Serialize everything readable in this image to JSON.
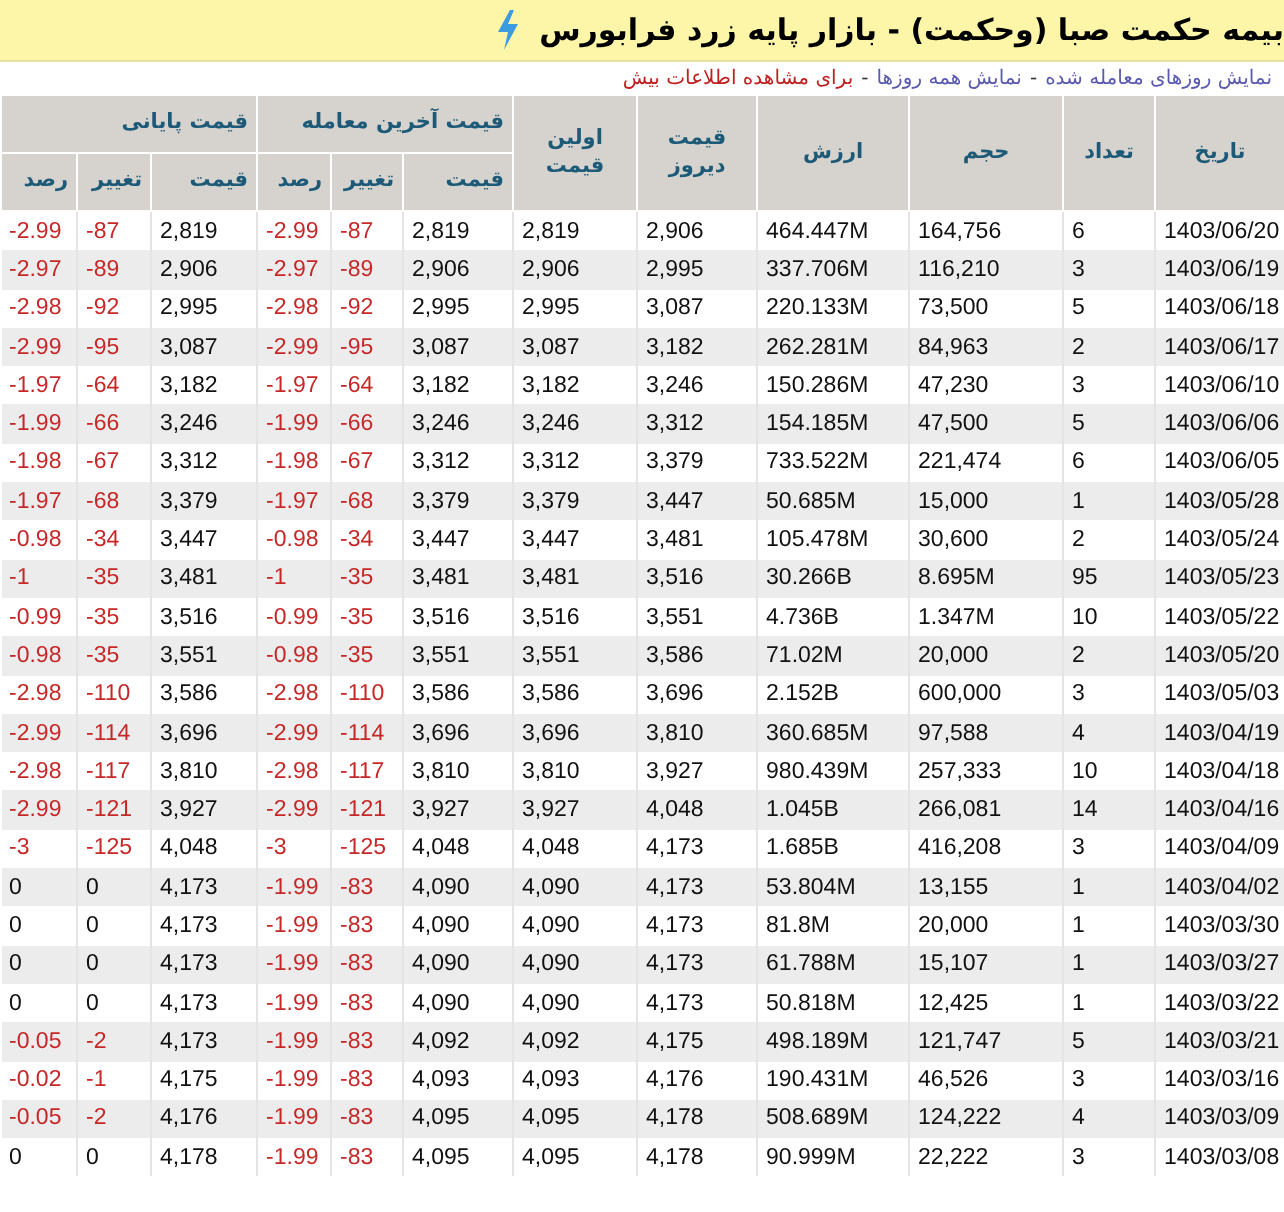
{
  "title": "بیمه حکمت صبا (وحکمت) - بازار پایه زرد فرابورس",
  "links": [
    {
      "text": "نمایش روزهای معامله شده",
      "kind": "link"
    },
    {
      "text": "-",
      "kind": "sep"
    },
    {
      "text": "نمایش همه روزها",
      "kind": "link"
    },
    {
      "text": "-",
      "kind": "sep"
    },
    {
      "text": "برای مشاهده اطلاعات بیش",
      "kind": "alert"
    }
  ],
  "table": {
    "columns": {
      "date": "تاریخ",
      "count": "تعداد",
      "volume": "حجم",
      "value": "ارزش",
      "yesterday_price": "قیمت دیروز",
      "first_price": "اولین قیمت",
      "last_trade": "قیمت آخرین معامله",
      "closing": "قیمت پایانی",
      "last_price": "قیمت",
      "last_change": "تغییر",
      "last_percent": "رصد",
      "close_price": "قیمت",
      "close_change": "تغییر",
      "close_percent": "رصد"
    },
    "rows": [
      {
        "date": "1403/06/20",
        "count": "6",
        "volume": "164,756",
        "value": "464.447M",
        "yesterday_price": "2,906",
        "first_price": "2,819",
        "last_price": "2,819",
        "last_change": "-87",
        "last_percent": "-2.99",
        "last_negative": true,
        "close_price": "2,819",
        "close_change": "-87",
        "close_percent": "-2.99",
        "close_negative": true
      },
      {
        "date": "1403/06/19",
        "count": "3",
        "volume": "116,210",
        "value": "337.706M",
        "yesterday_price": "2,995",
        "first_price": "2,906",
        "last_price": "2,906",
        "last_change": "-89",
        "last_percent": "-2.97",
        "last_negative": true,
        "close_price": "2,906",
        "close_change": "-89",
        "close_percent": "-2.97",
        "close_negative": true
      },
      {
        "date": "1403/06/18",
        "count": "5",
        "volume": "73,500",
        "value": "220.133M",
        "yesterday_price": "3,087",
        "first_price": "2,995",
        "last_price": "2,995",
        "last_change": "-92",
        "last_percent": "-2.98",
        "last_negative": true,
        "close_price": "2,995",
        "close_change": "-92",
        "close_percent": "-2.98",
        "close_negative": true
      },
      {
        "date": "1403/06/17",
        "count": "2",
        "volume": "84,963",
        "value": "262.281M",
        "yesterday_price": "3,182",
        "first_price": "3,087",
        "last_price": "3,087",
        "last_change": "-95",
        "last_percent": "-2.99",
        "last_negative": true,
        "close_price": "3,087",
        "close_change": "-95",
        "close_percent": "-2.99",
        "close_negative": true
      },
      {
        "date": "1403/06/10",
        "count": "3",
        "volume": "47,230",
        "value": "150.286M",
        "yesterday_price": "3,246",
        "first_price": "3,182",
        "last_price": "3,182",
        "last_change": "-64",
        "last_percent": "-1.97",
        "last_negative": true,
        "close_price": "3,182",
        "close_change": "-64",
        "close_percent": "-1.97",
        "close_negative": true
      },
      {
        "date": "1403/06/06",
        "count": "5",
        "volume": "47,500",
        "value": "154.185M",
        "yesterday_price": "3,312",
        "first_price": "3,246",
        "last_price": "3,246",
        "last_change": "-66",
        "last_percent": "-1.99",
        "last_negative": true,
        "close_price": "3,246",
        "close_change": "-66",
        "close_percent": "-1.99",
        "close_negative": true
      },
      {
        "date": "1403/06/05",
        "count": "6",
        "volume": "221,474",
        "value": "733.522M",
        "yesterday_price": "3,379",
        "first_price": "3,312",
        "last_price": "3,312",
        "last_change": "-67",
        "last_percent": "-1.98",
        "last_negative": true,
        "close_price": "3,312",
        "close_change": "-67",
        "close_percent": "-1.98",
        "close_negative": true
      },
      {
        "date": "1403/05/28",
        "count": "1",
        "volume": "15,000",
        "value": "50.685M",
        "yesterday_price": "3,447",
        "first_price": "3,379",
        "last_price": "3,379",
        "last_change": "-68",
        "last_percent": "-1.97",
        "last_negative": true,
        "close_price": "3,379",
        "close_change": "-68",
        "close_percent": "-1.97",
        "close_negative": true
      },
      {
        "date": "1403/05/24",
        "count": "2",
        "volume": "30,600",
        "value": "105.478M",
        "yesterday_price": "3,481",
        "first_price": "3,447",
        "last_price": "3,447",
        "last_change": "-34",
        "last_percent": "-0.98",
        "last_negative": true,
        "close_price": "3,447",
        "close_change": "-34",
        "close_percent": "-0.98",
        "close_negative": true
      },
      {
        "date": "1403/05/23",
        "count": "95",
        "volume": "8.695M",
        "value": "30.266B",
        "yesterday_price": "3,516",
        "first_price": "3,481",
        "last_price": "3,481",
        "last_change": "-35",
        "last_percent": "-1",
        "last_negative": true,
        "close_price": "3,481",
        "close_change": "-35",
        "close_percent": "-1",
        "close_negative": true
      },
      {
        "date": "1403/05/22",
        "count": "10",
        "volume": "1.347M",
        "value": "4.736B",
        "yesterday_price": "3,551",
        "first_price": "3,516",
        "last_price": "3,516",
        "last_change": "-35",
        "last_percent": "-0.99",
        "last_negative": true,
        "close_price": "3,516",
        "close_change": "-35",
        "close_percent": "-0.99",
        "close_negative": true
      },
      {
        "date": "1403/05/20",
        "count": "2",
        "volume": "20,000",
        "value": "71.02M",
        "yesterday_price": "3,586",
        "first_price": "3,551",
        "last_price": "3,551",
        "last_change": "-35",
        "last_percent": "-0.98",
        "last_negative": true,
        "close_price": "3,551",
        "close_change": "-35",
        "close_percent": "-0.98",
        "close_negative": true
      },
      {
        "date": "1403/05/03",
        "count": "3",
        "volume": "600,000",
        "value": "2.152B",
        "yesterday_price": "3,696",
        "first_price": "3,586",
        "last_price": "3,586",
        "last_change": "-110",
        "last_percent": "-2.98",
        "last_negative": true,
        "close_price": "3,586",
        "close_change": "-110",
        "close_percent": "-2.98",
        "close_negative": true
      },
      {
        "date": "1403/04/19",
        "count": "4",
        "volume": "97,588",
        "value": "360.685M",
        "yesterday_price": "3,810",
        "first_price": "3,696",
        "last_price": "3,696",
        "last_change": "-114",
        "last_percent": "-2.99",
        "last_negative": true,
        "close_price": "3,696",
        "close_change": "-114",
        "close_percent": "-2.99",
        "close_negative": true
      },
      {
        "date": "1403/04/18",
        "count": "10",
        "volume": "257,333",
        "value": "980.439M",
        "yesterday_price": "3,927",
        "first_price": "3,810",
        "last_price": "3,810",
        "last_change": "-117",
        "last_percent": "-2.98",
        "last_negative": true,
        "close_price": "3,810",
        "close_change": "-117",
        "close_percent": "-2.98",
        "close_negative": true
      },
      {
        "date": "1403/04/16",
        "count": "14",
        "volume": "266,081",
        "value": "1.045B",
        "yesterday_price": "4,048",
        "first_price": "3,927",
        "last_price": "3,927",
        "last_change": "-121",
        "last_percent": "-2.99",
        "last_negative": true,
        "close_price": "3,927",
        "close_change": "-121",
        "close_percent": "-2.99",
        "close_negative": true
      },
      {
        "date": "1403/04/09",
        "count": "3",
        "volume": "416,208",
        "value": "1.685B",
        "yesterday_price": "4,173",
        "first_price": "4,048",
        "last_price": "4,048",
        "last_change": "-125",
        "last_percent": "-3",
        "last_negative": true,
        "close_price": "4,048",
        "close_change": "-125",
        "close_percent": "-3",
        "close_negative": true
      },
      {
        "date": "1403/04/02",
        "count": "1",
        "volume": "13,155",
        "value": "53.804M",
        "yesterday_price": "4,173",
        "first_price": "4,090",
        "last_price": "4,090",
        "last_change": "-83",
        "last_percent": "-1.99",
        "last_negative": true,
        "close_price": "4,173",
        "close_change": "0",
        "close_percent": "0",
        "close_negative": false
      },
      {
        "date": "1403/03/30",
        "count": "1",
        "volume": "20,000",
        "value": "81.8M",
        "yesterday_price": "4,173",
        "first_price": "4,090",
        "last_price": "4,090",
        "last_change": "-83",
        "last_percent": "-1.99",
        "last_negative": true,
        "close_price": "4,173",
        "close_change": "0",
        "close_percent": "0",
        "close_negative": false
      },
      {
        "date": "1403/03/27",
        "count": "1",
        "volume": "15,107",
        "value": "61.788M",
        "yesterday_price": "4,173",
        "first_price": "4,090",
        "last_price": "4,090",
        "last_change": "-83",
        "last_percent": "-1.99",
        "last_negative": true,
        "close_price": "4,173",
        "close_change": "0",
        "close_percent": "0",
        "close_negative": false
      },
      {
        "date": "1403/03/22",
        "count": "1",
        "volume": "12,425",
        "value": "50.818M",
        "yesterday_price": "4,173",
        "first_price": "4,090",
        "last_price": "4,090",
        "last_change": "-83",
        "last_percent": "-1.99",
        "last_negative": true,
        "close_price": "4,173",
        "close_change": "0",
        "close_percent": "0",
        "close_negative": false
      },
      {
        "date": "1403/03/21",
        "count": "5",
        "volume": "121,747",
        "value": "498.189M",
        "yesterday_price": "4,175",
        "first_price": "4,092",
        "last_price": "4,092",
        "last_change": "-83",
        "last_percent": "-1.99",
        "last_negative": true,
        "close_price": "4,173",
        "close_change": "-2",
        "close_percent": "-0.05",
        "close_negative": true
      },
      {
        "date": "1403/03/16",
        "count": "3",
        "volume": "46,526",
        "value": "190.431M",
        "yesterday_price": "4,176",
        "first_price": "4,093",
        "last_price": "4,093",
        "last_change": "-83",
        "last_percent": "-1.99",
        "last_negative": true,
        "close_price": "4,175",
        "close_change": "-1",
        "close_percent": "-0.02",
        "close_negative": true
      },
      {
        "date": "1403/03/09",
        "count": "4",
        "volume": "124,222",
        "value": "508.689M",
        "yesterday_price": "4,178",
        "first_price": "4,095",
        "last_price": "4,095",
        "last_change": "-83",
        "last_percent": "-1.99",
        "last_negative": true,
        "close_price": "4,176",
        "close_change": "-2",
        "close_percent": "-0.05",
        "close_negative": true
      },
      {
        "date": "1403/03/08",
        "count": "3",
        "volume": "22,222",
        "value": "90.999M",
        "yesterday_price": "4,178",
        "first_price": "4,095",
        "last_price": "4,095",
        "last_change": "-83",
        "last_percent": "-1.99",
        "last_negative": true,
        "close_price": "4,178",
        "close_change": "0",
        "close_percent": "0",
        "close_negative": false
      }
    ]
  }
}
